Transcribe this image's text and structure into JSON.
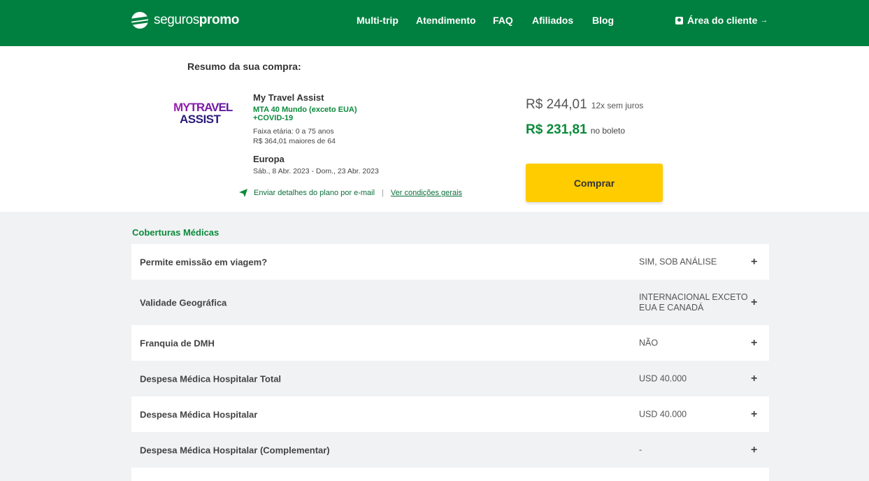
{
  "header": {
    "logo_part1": "seguros",
    "logo_part2": "promo",
    "nav": [
      "Multi-trip",
      "Atendimento",
      "FAQ",
      "Afiliados",
      "Blog"
    ],
    "client_area": "Área do cliente",
    "client_arrow": "→"
  },
  "summary": {
    "title": "Resumo da sua compra:",
    "brand_logo_text": [
      "MYTRAVEL",
      "ASSIST"
    ],
    "plan_name": "My Travel Assist",
    "plan_sub_line1": "MTA 40 Mundo (exceto EUA)",
    "plan_sub_line2": "+COVID-19",
    "age_range": "Faixa etária: 0 a 75 anos",
    "age_over": "R$ 364,01 maiores de 64",
    "destination": "Europa",
    "dates": "Sáb., 8 Abr. 2023 - Dom., 23 Abr. 2023",
    "email_link": "Enviar detalhes do plano por e-mail",
    "separator": "|",
    "terms_link": "Ver condições gerais",
    "price_installments": "R$ 244,01",
    "installments_note": "12x sem juros",
    "price_boleto": "R$ 231,81",
    "boleto_note": "no boleto",
    "buy_label": "Comprar"
  },
  "coverage": {
    "title": "Coberturas Médicas",
    "rows": [
      {
        "label": "Permite emissão em viagem?",
        "value": "SIM, SOB ANÁLISE",
        "toggle": "+"
      },
      {
        "label": "Validade Geográfica",
        "value": "INTERNACIONAL EXCETO EUA E CANADÁ",
        "toggle": "+"
      },
      {
        "label": "Franquia de DMH",
        "value": "NÃO",
        "toggle": "+"
      },
      {
        "label": "Despesa Médica Hospitalar Total",
        "value": "USD 40.000",
        "toggle": "+"
      },
      {
        "label": "Despesa Médica Hospitalar",
        "value": "USD 40.000",
        "toggle": "+"
      },
      {
        "label": "Despesa Médica Hospitalar (Complementar)",
        "value": "-",
        "toggle": "+"
      }
    ]
  },
  "colors": {
    "brand_green": "#008040",
    "text_green": "#0a8a3a",
    "buy_yellow": "#ffcc00",
    "logo_purple": "#7a1fa2"
  }
}
